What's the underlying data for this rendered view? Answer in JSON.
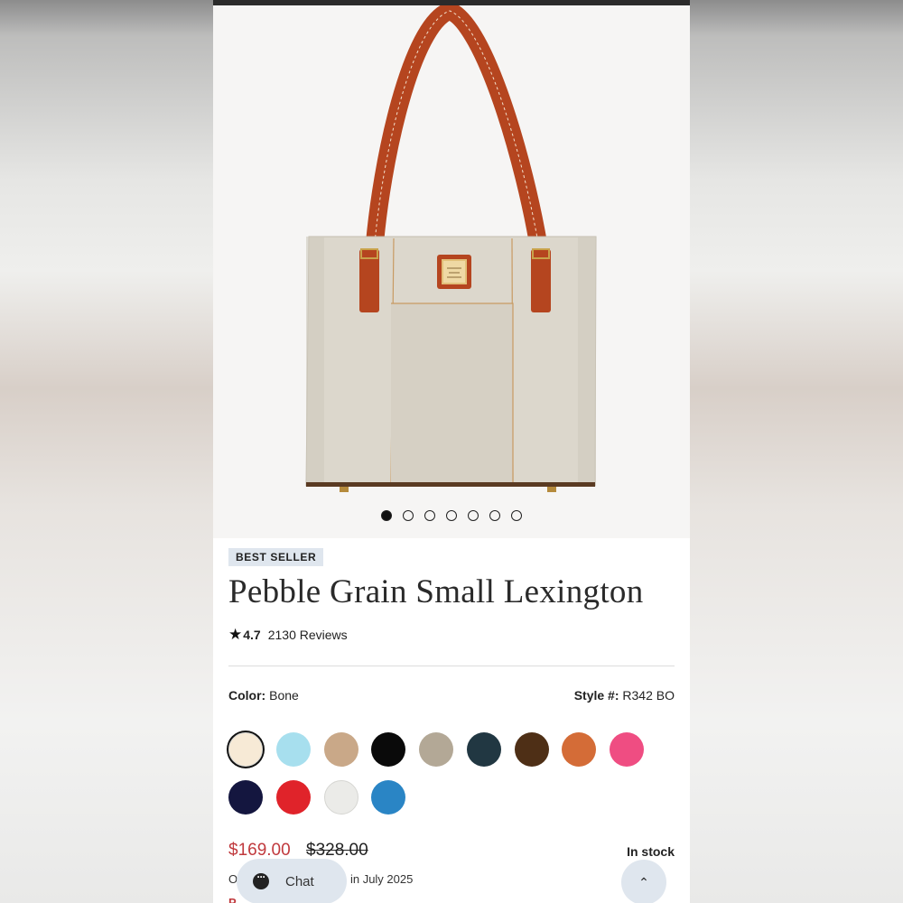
{
  "product": {
    "badge": "BEST SELLER",
    "title": "Pebble Grain Small Lexington",
    "rating": "4.7",
    "reviews": "2130 Reviews",
    "color_label": "Color:",
    "color_value": "Bone",
    "style_label": "Style #:",
    "style_value": "R342 BO",
    "price_sale": "$169.00",
    "price_original": "$328.00",
    "stock": "In stock",
    "shipping_prefix": "O",
    "shipping_suffix": "ing in July 2025",
    "promo_peek": "P"
  },
  "gallery": {
    "image_count": 7,
    "active_index": 0
  },
  "swatches": [
    {
      "name": "Bone",
      "color": "#f7ead6",
      "selected": true
    },
    {
      "name": "Light Blue",
      "color": "#a7dfee"
    },
    {
      "name": "Tan",
      "color": "#c9a888"
    },
    {
      "name": "Black",
      "color": "#0a0a0a"
    },
    {
      "name": "Taupe",
      "color": "#b3a896"
    },
    {
      "name": "Dark Slate",
      "color": "#213742"
    },
    {
      "name": "Brown",
      "color": "#4e2f16"
    },
    {
      "name": "Orange",
      "color": "#d46c37"
    },
    {
      "name": "Pink",
      "color": "#ef4d82"
    },
    {
      "name": "Navy",
      "color": "#14163f"
    },
    {
      "name": "Red",
      "color": "#e0232a"
    },
    {
      "name": "White",
      "color": "#ebebe8"
    },
    {
      "name": "Blue",
      "color": "#2a85c5"
    }
  ],
  "chat": {
    "label": "Chat"
  },
  "colors": {
    "sale": "#c0393d",
    "bag_body": "#dcd7cc",
    "strap": "#b5451f",
    "badge_bg": "#dfe6ee"
  }
}
